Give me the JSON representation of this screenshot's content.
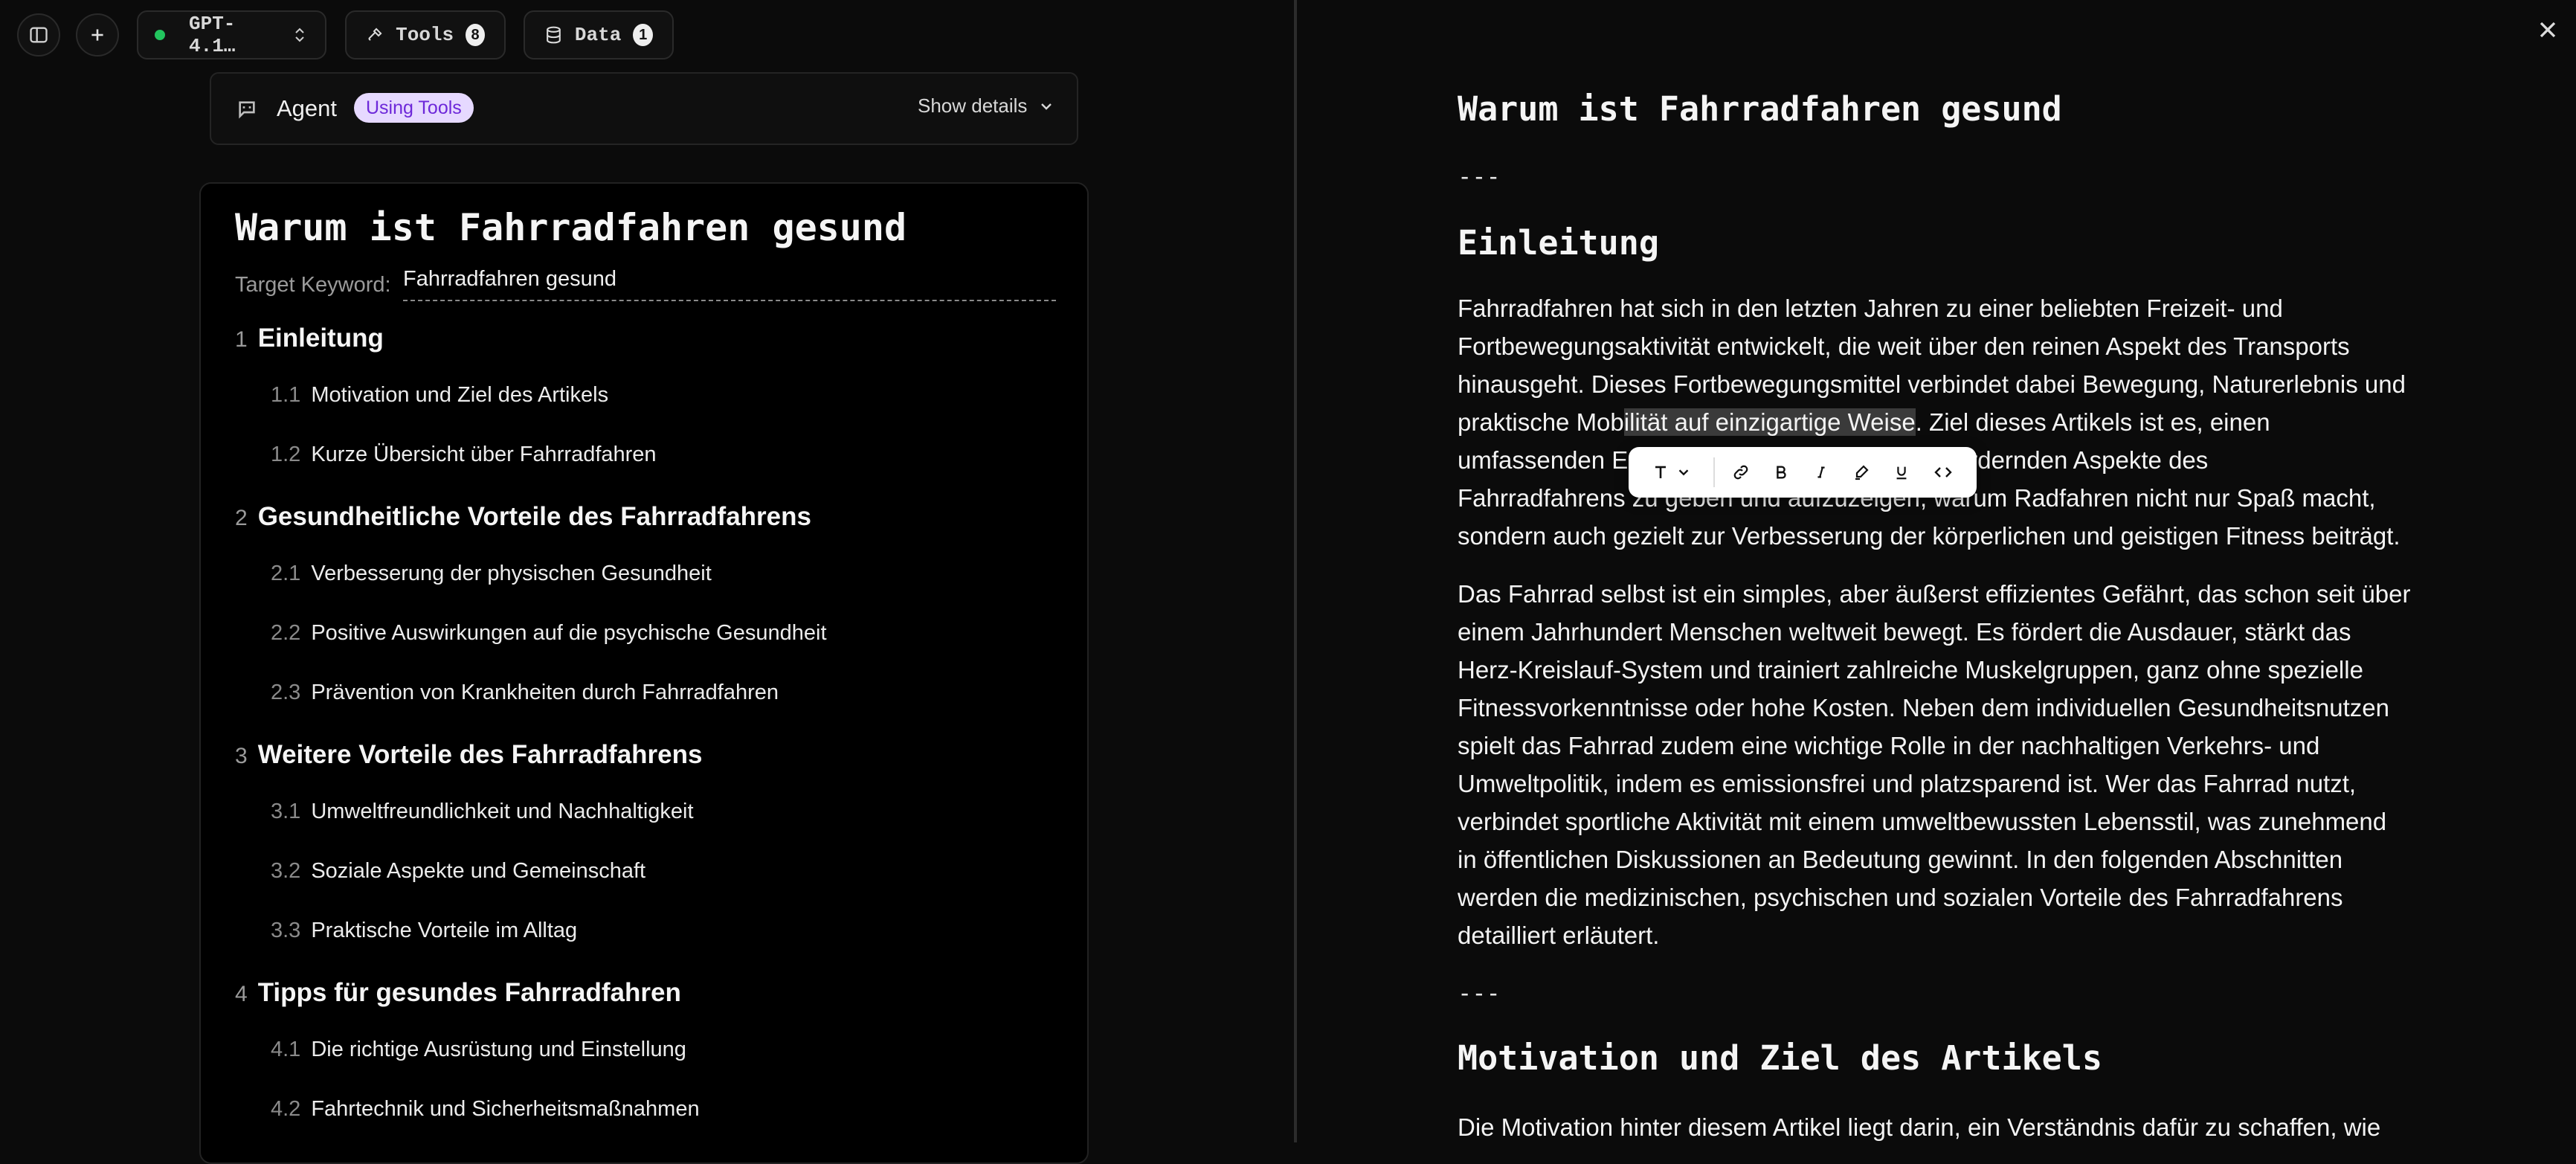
{
  "topbar": {
    "model": "GPT-4.1…",
    "model_status_color": "#22c55e",
    "tools_label": "Tools",
    "tools_count": "8",
    "data_label": "Data",
    "data_count": "1",
    "close_glyph": "✕"
  },
  "agent": {
    "label": "Agent",
    "status_badge": "Using Tools",
    "show_details": "Show details"
  },
  "outline": {
    "title": "Warum ist Fahrradfahren gesund",
    "keyword_label": "Target Keyword:",
    "keyword_value": "Fahrradfahren gesund",
    "items": [
      {
        "num": "1",
        "label": "Einleitung",
        "level": 1
      },
      {
        "num": "1.1",
        "label": "Motivation und Ziel des Artikels",
        "level": 2
      },
      {
        "num": "1.2",
        "label": "Kurze Übersicht über Fahrradfahren",
        "level": 2
      },
      {
        "num": "2",
        "label": "Gesundheitliche Vorteile des Fahrradfahrens",
        "level": 1
      },
      {
        "num": "2.1",
        "label": "Verbesserung der physischen Gesundheit",
        "level": 2
      },
      {
        "num": "2.2",
        "label": "Positive Auswirkungen auf die psychische Gesundheit",
        "level": 2
      },
      {
        "num": "2.3",
        "label": "Prävention von Krankheiten durch Fahrradfahren",
        "level": 2
      },
      {
        "num": "3",
        "label": "Weitere Vorteile des Fahrradfahrens",
        "level": 1
      },
      {
        "num": "3.1",
        "label": "Umweltfreundlichkeit und Nachhaltigkeit",
        "level": 2
      },
      {
        "num": "3.2",
        "label": "Soziale Aspekte und Gemeinschaft",
        "level": 2
      },
      {
        "num": "3.3",
        "label": "Praktische Vorteile im Alltag",
        "level": 2
      },
      {
        "num": "4",
        "label": "Tipps für gesundes Fahrradfahren",
        "level": 1
      },
      {
        "num": "4.1",
        "label": "Die richtige Ausrüstung und Einstellung",
        "level": 2
      },
      {
        "num": "4.2",
        "label": "Fahrtechnik und Sicherheitsmaßnahmen",
        "level": 2
      }
    ]
  },
  "article": {
    "title": "Warum ist Fahrradfahren gesund",
    "separator": "---",
    "section1_heading": "Einleitung",
    "p1_lines": [
      "Fahrradfahren hat sich in den letzten Jahren zu einer beliebten Freizeit- und",
      "Fortbewegungsaktivität entwickelt, die weit über den reinen Aspekt des Transports",
      "hinausgeht. Dieses Fortbewegungsmittel verbindet dabei Bewegung, Naturerlebnis und"
    ],
    "p1_line4_before": "praktische Mob",
    "p1_line4_highlight": "ilität auf einzigartige Weise",
    "p1_line4_after": ". Ziel dieses Artikels ist es, einen",
    "p1_line5_a": "umfassenden E",
    "p1_line5_b": "heitsfördernden Aspekte des",
    "p1_line6_a": "Fahrradfahrens zu geben und aufzuzeigen, warum Radfahren nicht nur Spaß macht,",
    "p1_line7": "sondern auch gezielt zur Verbesserung der körperlichen und geistigen Fitness beiträgt.",
    "p2_lines": [
      "Das Fahrrad selbst ist ein simples, aber äußerst effizientes Gefährt, das schon seit über",
      "einem Jahrhundert Menschen weltweit bewegt. Es fördert die Ausdauer, stärkt das",
      "Herz-Kreislauf-System und trainiert zahlreiche Muskelgruppen, ganz ohne spezielle",
      "Fitnessvorkenntnisse oder hohe Kosten. Neben dem individuellen Gesundheitsnutzen",
      "spielt das Fahrrad zudem eine wichtige Rolle in der nachhaltigen Verkehrs- und",
      "Umweltpolitik, indem es emissionsfrei und platzsparend ist. Wer das Fahrrad nutzt,",
      "verbindet sportliche Aktivität mit einem umweltbewussten Lebensstil, was zunehmend",
      "in öffentlichen Diskussionen an Bedeutung gewinnt. In den folgenden Abschnitten",
      "werden die medizinischen, psychischen und sozialen Vorteile des Fahrradfahrens",
      "detailliert erläutert."
    ],
    "separator2": "---",
    "section2_heading": "Motivation und Ziel des Artikels",
    "p3_line1": "Die Motivation hinter diesem Artikel liegt darin, ein Verständnis dafür zu schaffen, wie"
  },
  "format_toolbar": {
    "items": [
      "text-style",
      "chevron-down",
      "link",
      "bold",
      "italic",
      "highlight",
      "underline",
      "code"
    ]
  }
}
